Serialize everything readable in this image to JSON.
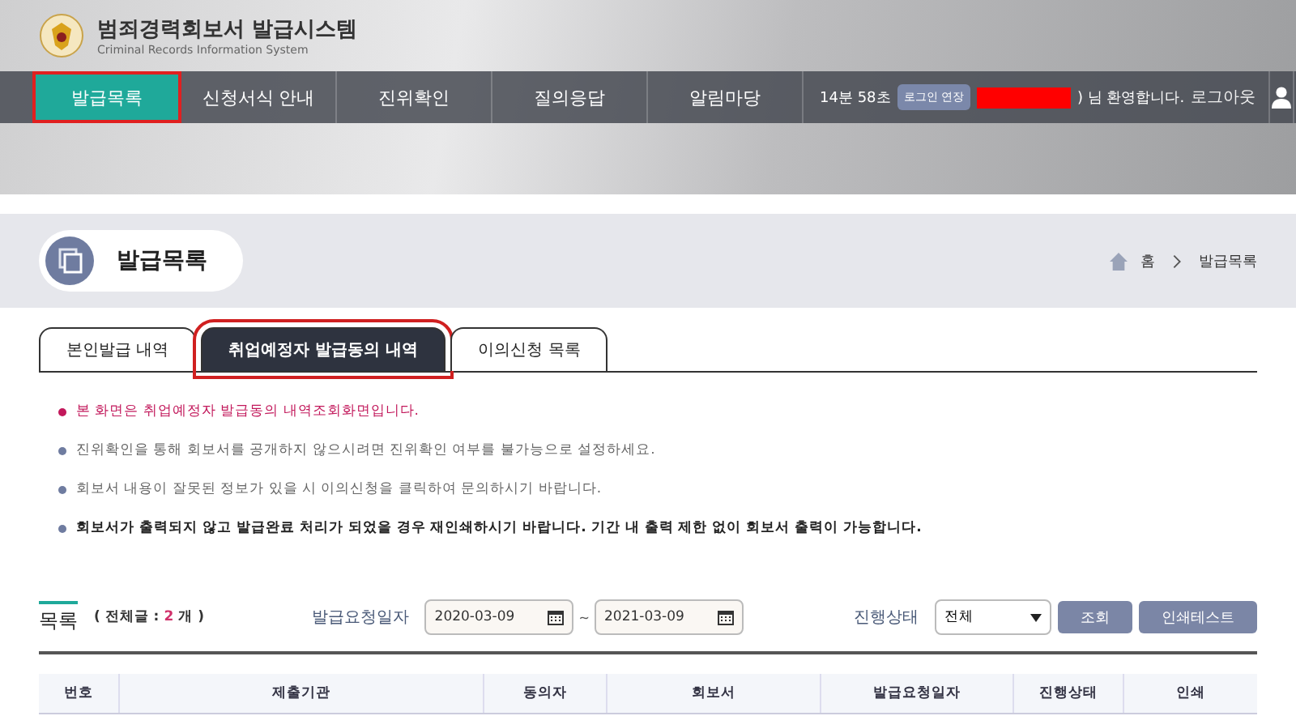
{
  "site": {
    "title": "범죄경력회보서 발급시스템",
    "subtitle": "Criminal Records Information System"
  },
  "nav": [
    {
      "label": "발급목록",
      "selected": true,
      "highlighted": true
    },
    {
      "label": "신청서식 안내",
      "selected": false,
      "highlighted": false
    },
    {
      "label": "진위확인",
      "selected": false,
      "highlighted": false
    },
    {
      "label": "질의응답",
      "selected": false,
      "highlighted": false
    },
    {
      "label": "알림마당",
      "selected": false,
      "highlighted": false
    }
  ],
  "session": {
    "timer": "14분 58초",
    "extend_button": "로그인 연장",
    "greeting": ") 님 환영합니다.",
    "logout": "로그아웃"
  },
  "page_title": "발급목록",
  "breadcrumb": [
    "홈",
    "발급목록"
  ],
  "tabs": [
    {
      "label": "본인발급 내역",
      "selected": false,
      "highlighted": false
    },
    {
      "label": "취업예정자 발급동의 내역",
      "selected": true,
      "highlighted": true
    },
    {
      "label": "이의신청 목록",
      "selected": false,
      "highlighted": false
    }
  ],
  "notices": [
    {
      "text": "본 화면은 취업예정자 발급동의 내역조회화면입니다.",
      "kind": "alert"
    },
    {
      "text": "진위확인을 통해 회보서를 공개하지 않으시려면 진위확인 여부를 불가능으로 설정하세요.",
      "kind": "normal"
    },
    {
      "text": "회보서 내용이 잘못된 정보가 있을 시 이의신청을 클릭하여 문의하시기 바랍니다.",
      "kind": "normal"
    },
    {
      "text": "회보서가 출력되지 않고 발급완료 처리가 되었을 경우 재인쇄하시기 바랍니다. 기간 내 출력 제한 없이 회보서 출력이 가능합니다.",
      "kind": "strong"
    }
  ],
  "list": {
    "title": "목록",
    "count_label": "( 전체글 :",
    "count": "2",
    "count_unit": "개 )"
  },
  "filters": {
    "date_label": "발급요청일자",
    "date_from": "2020-03-09",
    "date_sep": "~",
    "date_to": "2021-03-09",
    "status_label": "진행상태",
    "status_value": "전체",
    "search_button": "조회",
    "print_test_button": "인쇄테스트"
  },
  "table": {
    "columns": [
      "번호",
      "제출기관",
      "동의자",
      "회보서",
      "발급요청일자",
      "진행상태",
      "인쇄"
    ]
  }
}
